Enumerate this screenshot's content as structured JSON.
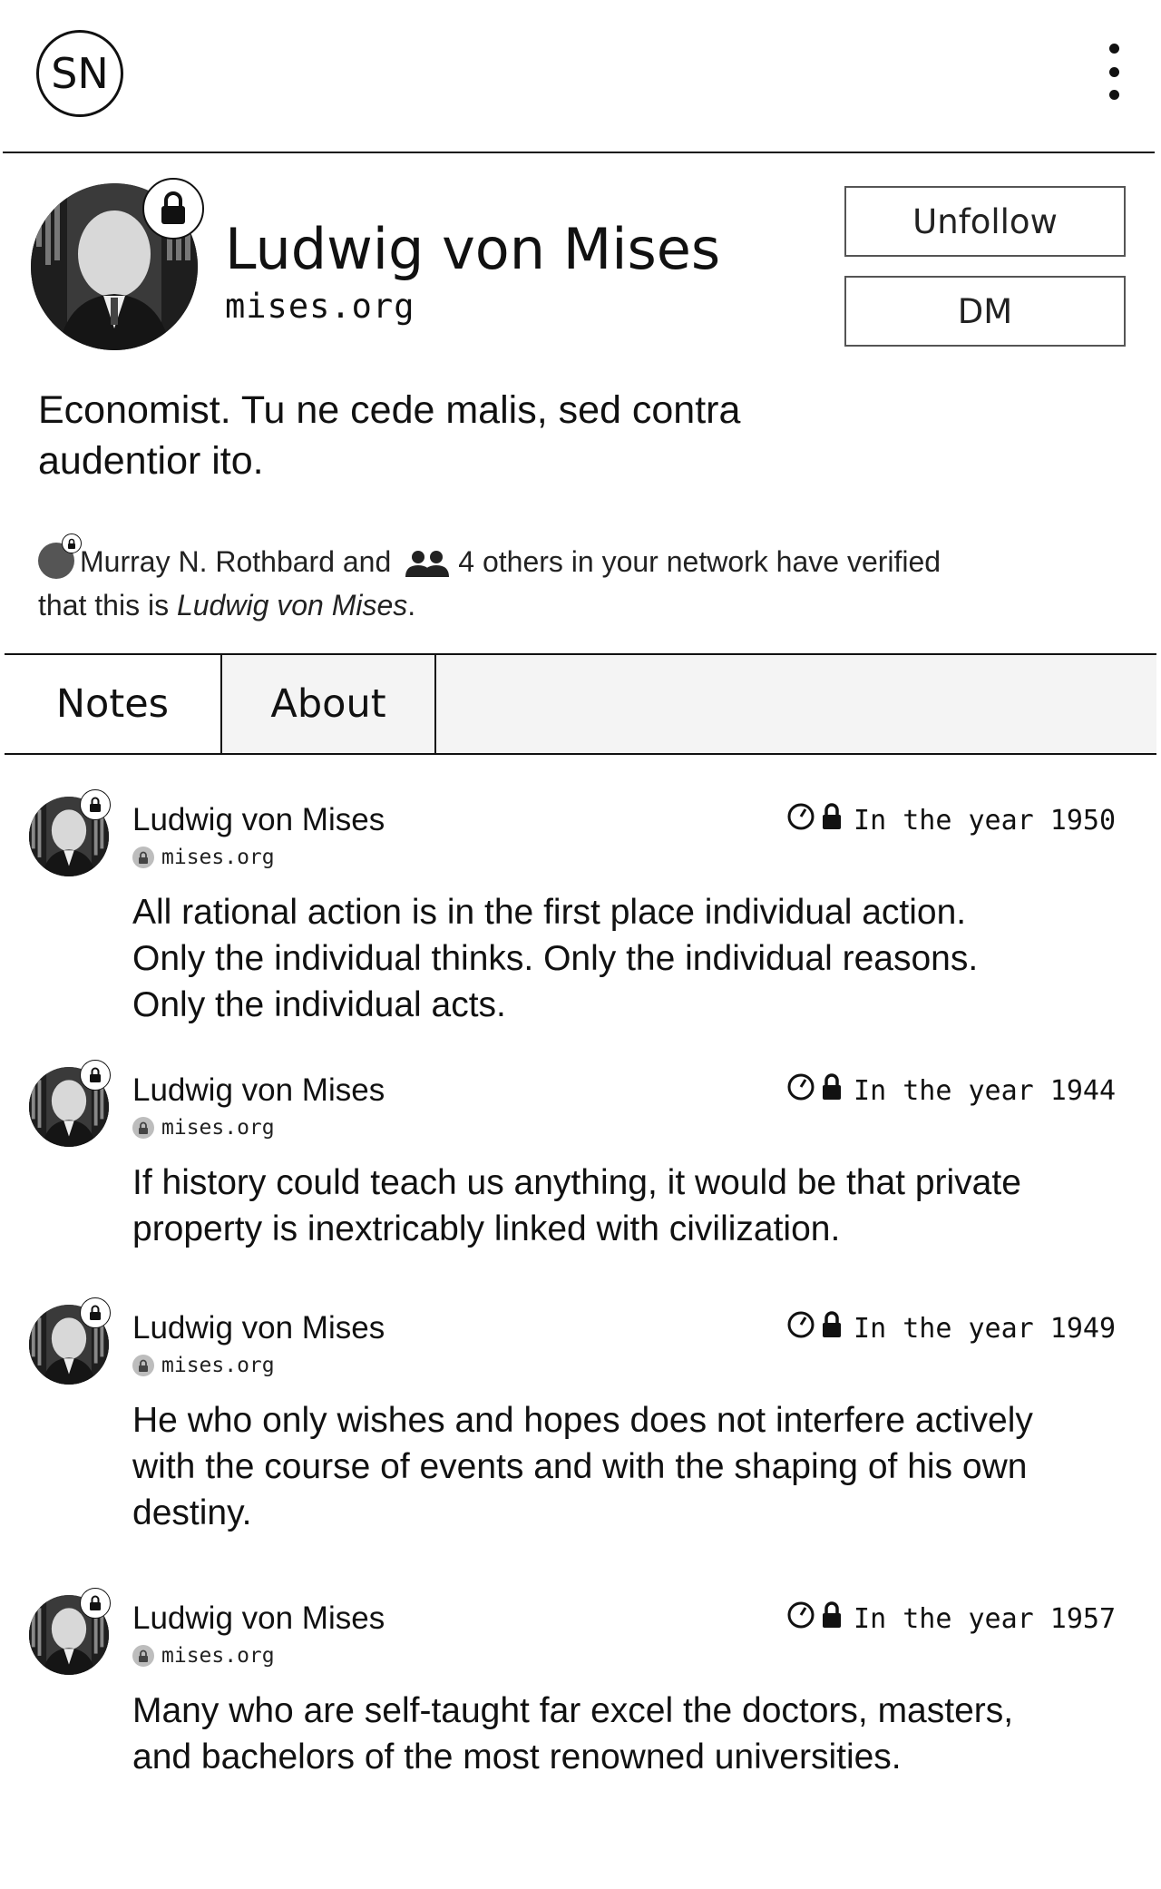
{
  "header": {
    "logo_text": "SN",
    "menu_icon": "more-vertical-icon"
  },
  "profile": {
    "name": "Ludwig von Mises",
    "domain": "mises.org",
    "bio": "Economist. Tu ne cede malis, sed contra audentior ito.",
    "unfollow_label": "Unfollow",
    "dm_label": "DM",
    "verified_by": "Murray N. Rothbard and",
    "verified_others": "4 others in your network have verified",
    "verified_suffix_pre": "that this is",
    "verified_name": "Ludwig von Mises",
    "verified_suffix_post": "."
  },
  "tabs": [
    {
      "label": "Notes",
      "active": true
    },
    {
      "label": "About",
      "active": false
    }
  ],
  "notes": [
    {
      "author": "Ludwig von Mises",
      "domain": "mises.org",
      "time": "In the year 1950",
      "text": "All rational action is in the first place individual action. Only the individual thinks. Only the individual reasons. Only the individual acts."
    },
    {
      "author": "Ludwig von Mises",
      "domain": "mises.org",
      "time": "In the year 1944",
      "text": "If history could teach us anything, it would be that private property is inextricably linked with civilization."
    },
    {
      "author": "Ludwig von Mises",
      "domain": "mises.org",
      "time": "In the year 1949",
      "text": "He who only wishes and hopes does not interfere actively with the course of events and with the shaping of his own destiny."
    },
    {
      "author": "Ludwig von Mises",
      "domain": "mises.org",
      "time": "In the year 1957",
      "text": "Many who are self-taught far excel the doctors, masters, and bachelors of the most renowned universities."
    }
  ]
}
